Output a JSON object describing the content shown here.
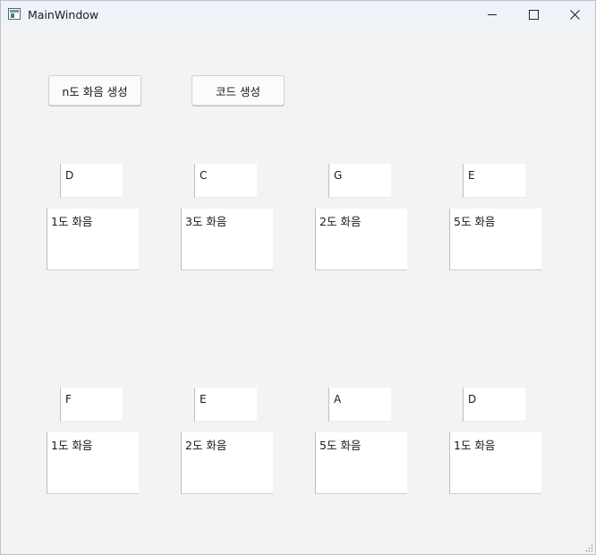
{
  "window": {
    "title": "MainWindow"
  },
  "buttons": {
    "generate_nth": "n도 화음 생성",
    "generate_code": "코드 생성"
  },
  "rows": [
    {
      "notes": [
        "D",
        "C",
        "G",
        "E"
      ],
      "harmonies": [
        "1도 화음",
        "3도 화음",
        "2도 화음",
        "5도 화음"
      ]
    },
    {
      "notes": [
        "F",
        "E",
        "A",
        "D"
      ],
      "harmonies": [
        "1도 화음",
        "2도 화음",
        "5도 화음",
        "1도 화음"
      ]
    }
  ],
  "icons": {
    "app": "app-icon",
    "minimize": "minimize-icon",
    "maximize": "maximize-icon",
    "close": "close-icon",
    "grip": "resize-grip-icon"
  }
}
